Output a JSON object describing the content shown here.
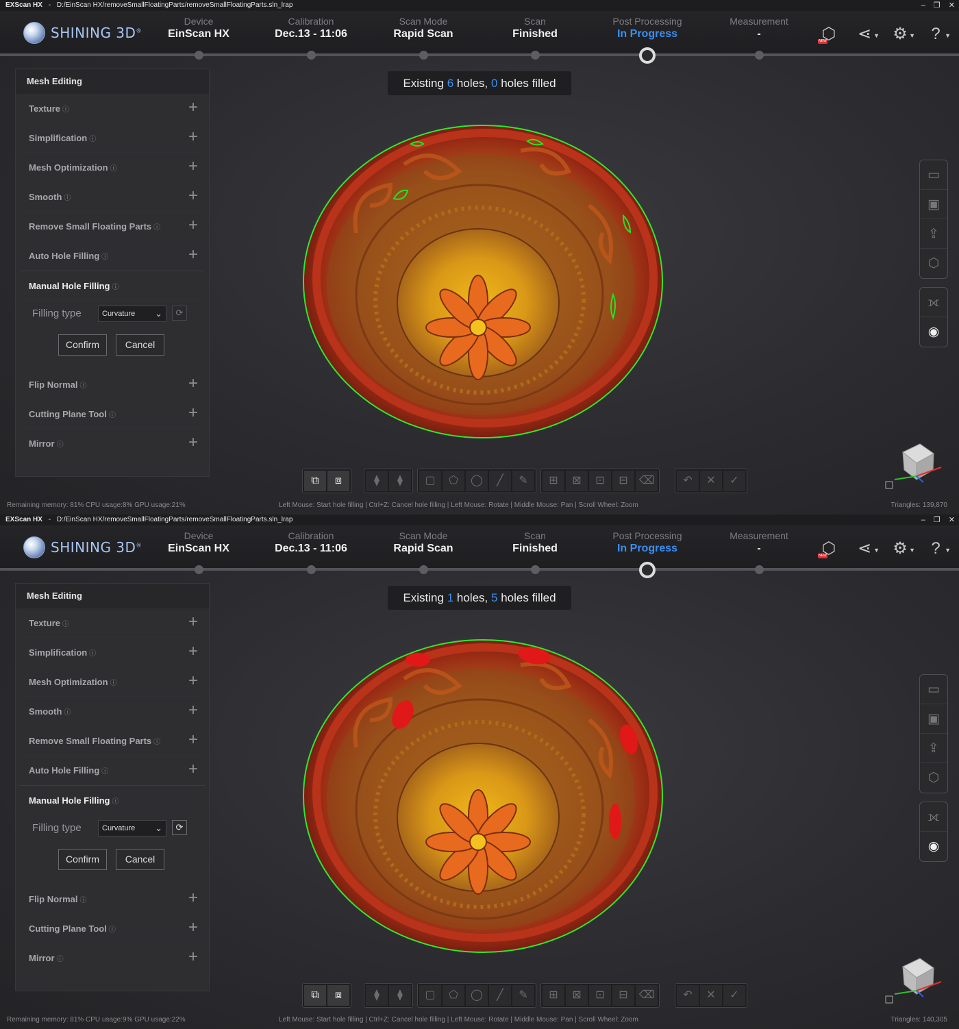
{
  "window": {
    "app_name": "EXScan HX",
    "separator": "-",
    "path": "D:/EinScan HX/removeSmallFloatingParts/removeSmallFloatingParts.sln_lrap",
    "controls": [
      "–",
      "❐",
      "✕"
    ]
  },
  "logo": {
    "text": "SHINING 3D",
    "mark": "®"
  },
  "steps": [
    {
      "label": "Device",
      "value": "EinScan HX"
    },
    {
      "label": "Calibration",
      "value": "Dec.13 - 11:06"
    },
    {
      "label": "Scan Mode",
      "value": "Rapid Scan"
    },
    {
      "label": "Scan",
      "value": "Finished"
    },
    {
      "label": "Post Processing",
      "value": "In Progress"
    },
    {
      "label": "Measurement",
      "value": "-"
    }
  ],
  "header_icons": [
    "new-feature-icon",
    "share-icon",
    "settings-icon",
    "help-icon"
  ],
  "new_badge": "NEW",
  "panel": {
    "title": "Mesh Editing",
    "items_top": [
      "Texture",
      "Simplification",
      "Mesh Optimization",
      "Smooth",
      "Remove Small Floating Parts",
      "Auto Hole Filling"
    ],
    "manual": "Manual Hole Filling",
    "filling_type_label": "Filling type",
    "filling_type_value": "Curvature",
    "confirm": "Confirm",
    "cancel": "Cancel",
    "items_bottom": [
      "Flip Normal",
      "Cutting Plane Tool",
      "Mirror"
    ]
  },
  "counter": {
    "prefix": "Existing",
    "holes_word": "holes,",
    "filled_word": "holes filled"
  },
  "shots": [
    {
      "existing": "6",
      "filled": "0",
      "memory": "Remaining memory: 81% CPU usage:8%  GPU usage:21%",
      "triangles": "Triangles: 139,870",
      "filled_patches": false,
      "refresh_enabled": false
    },
    {
      "existing": "1",
      "filled": "5",
      "memory": "Remaining memory: 81% CPU usage:9%  GPU usage:22%",
      "triangles": "Triangles: 140,305",
      "filled_patches": true,
      "refresh_enabled": true
    }
  ],
  "status_hint": "Left Mouse: Start hole filling | Ctrl+Z: Cancel hole filling | Left Mouse: Rotate | Middle Mouse: Pan | Scroll Wheel: Zoom",
  "colors": {
    "accent": "#3a8ff0",
    "hole_outline": "#22e622",
    "filled_patch": "#e01818"
  }
}
